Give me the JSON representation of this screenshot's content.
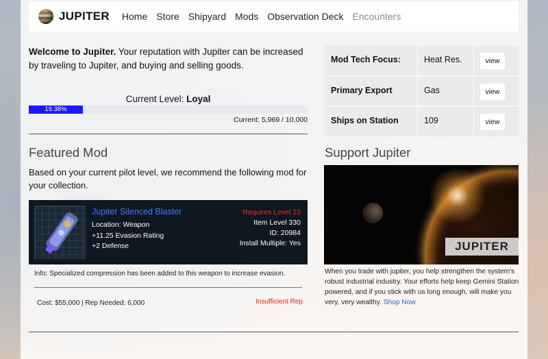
{
  "nav": {
    "brand": "JUPITER",
    "items": [
      "Home",
      "Store",
      "Shipyard",
      "Mods",
      "Observation Deck",
      "Encounters"
    ]
  },
  "welcome": {
    "bold": "Welcome to Jupiter.",
    "text": " Your reputation with Jupiter can be increased by traveling to Jupiter, and buying and selling goods."
  },
  "level": {
    "label": "Current Level: ",
    "value": "Loyal",
    "progress_pct": 19.38,
    "progress_label": "19.38%",
    "current_text": "Current: 5,969 / 10,000"
  },
  "featured": {
    "title": "Featured Mod",
    "recommend": "Based on your current pilot level, we recommend the following mod for your collection.",
    "mod": {
      "name": "Jupiter Silenced Blaster",
      "location": "Location: Weapon",
      "stat1": "+11.25 Evasion Rating",
      "stat2": "+2 Defense",
      "requires": "Requires Level 23",
      "item_level": "Item Level 330",
      "id": "ID: 20984",
      "install": "Install Multiple: Yes"
    },
    "info": "Info: Specialized compression has been added to this weapon to increase evasion.",
    "cost": "Cost: $55,000 | Rep Needed: 6,000",
    "status": "Insufficient Rep"
  },
  "info_table": {
    "rows": [
      {
        "label": "Mod Tech Focus:",
        "value": "Heat Res.",
        "button": "view"
      },
      {
        "label": "Primary Export",
        "value": "Gas",
        "button": "view"
      },
      {
        "label": "Ships on Station",
        "value": "109",
        "button": "view"
      }
    ]
  },
  "support": {
    "title": "Support Jupiter",
    "image_label": "JUPITER",
    "text": "When you trade with jupiter, you help strengthen the system's robust industrial industry. Your efforts help keep Gemini Station powered, and if you stick with us long enough, will make you very, very wealthy.",
    "link": "Shop Now"
  }
}
